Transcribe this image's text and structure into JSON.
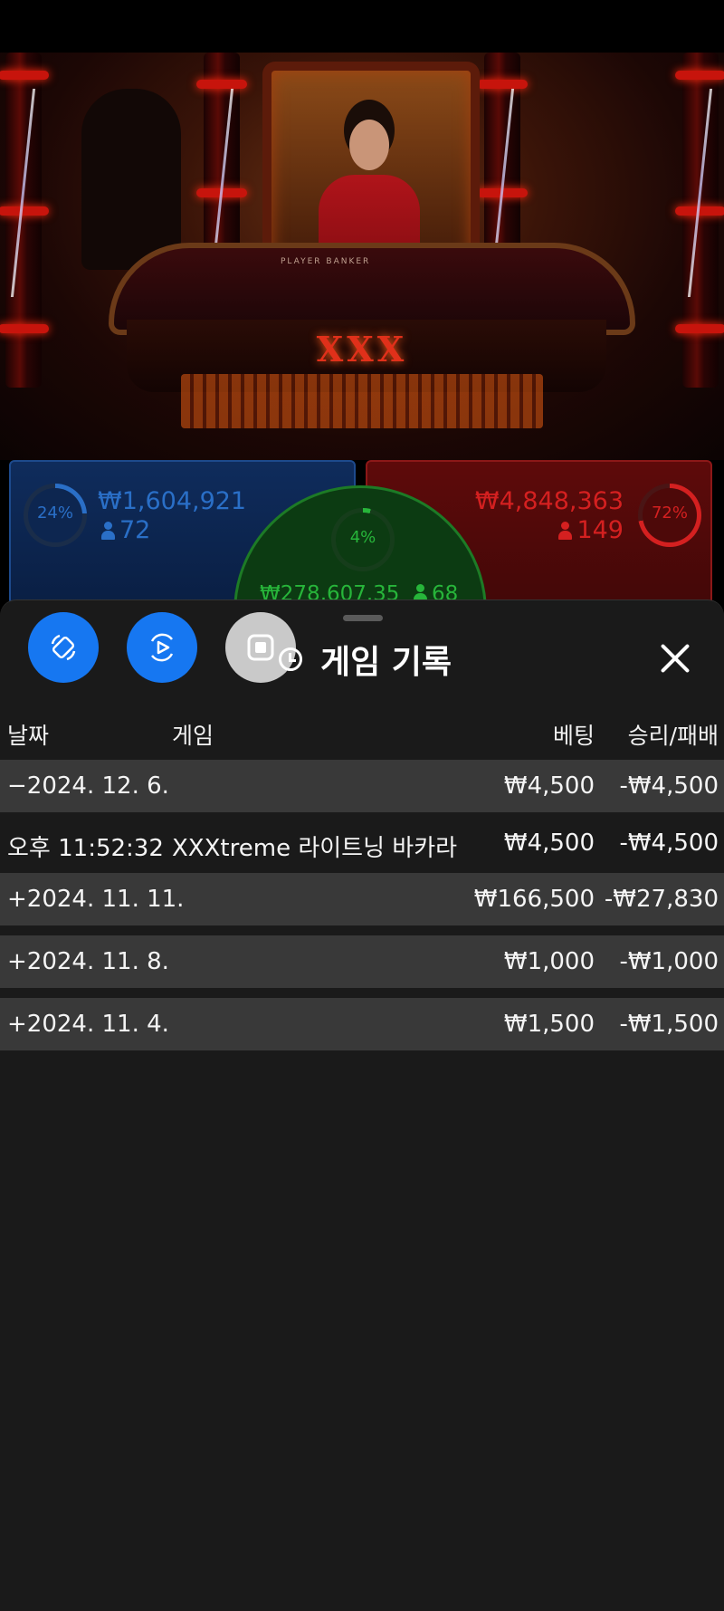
{
  "video": {
    "table_logo": "XXX",
    "table_labels": "PLAYER   BANKER"
  },
  "bets": {
    "player": {
      "percent": "24%",
      "amount": "₩1,604,921",
      "players": "72",
      "color": "#2a6fc7"
    },
    "tie": {
      "percent": "4%",
      "amount": "₩278,607.35",
      "players": "68",
      "color": "#27b53a"
    },
    "banker": {
      "percent": "72%",
      "amount": "₩4,848,363",
      "players": "149",
      "color": "#d42020"
    }
  },
  "sheet": {
    "title": "게임 기록",
    "buttons": [
      "rotate-screen-icon",
      "screen-record-icon",
      "stop-icon"
    ],
    "columns": {
      "date": "날짜",
      "game": "게임",
      "bet": "베팅",
      "win_loss": "승리/패배"
    },
    "rows": [
      {
        "date": "−2024. 12. 6.",
        "game": "",
        "bet": "₩4,500",
        "win_loss": "-₩4,500",
        "kind": "group"
      },
      {
        "date": "오후 11:52:32",
        "game": "XXXtreme 라이트닝 바카라",
        "bet": "₩4,500",
        "win_loss": "-₩4,500",
        "kind": "detail"
      },
      {
        "date": "+2024. 11. 11.",
        "game": "",
        "bet": "₩166,500",
        "win_loss": "-₩27,830",
        "kind": "group"
      },
      {
        "date": "+2024. 11. 8.",
        "game": "",
        "bet": "₩1,000",
        "win_loss": "-₩1,000",
        "kind": "group"
      },
      {
        "date": "+2024. 11. 4.",
        "game": "",
        "bet": "₩1,500",
        "win_loss": "-₩1,500",
        "kind": "group"
      }
    ]
  }
}
